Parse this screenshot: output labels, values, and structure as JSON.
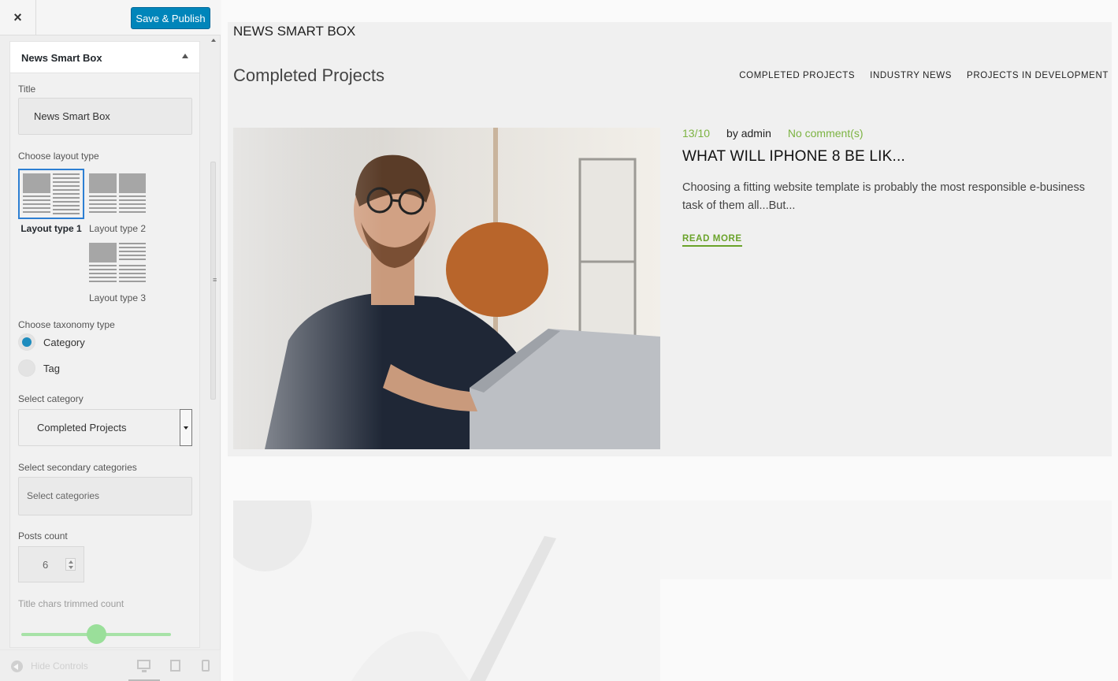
{
  "topbar": {
    "close_symbol": "×",
    "save_label": "Save & Publish"
  },
  "section": {
    "title": "News Smart Box"
  },
  "form": {
    "title_label": "Title",
    "title_value": "News Smart Box",
    "layout_label": "Choose layout type",
    "layouts": [
      {
        "label": "Layout type 1",
        "selected": true
      },
      {
        "label": "Layout type 2",
        "selected": false
      },
      {
        "label": "Layout type 3",
        "selected": false
      }
    ],
    "taxonomy_label": "Choose taxonomy type",
    "taxonomy_options": [
      {
        "label": "Category",
        "selected": true
      },
      {
        "label": "Tag",
        "selected": false
      }
    ],
    "category_label": "Select category",
    "category_value": "Completed Projects",
    "secondary_label": "Select secondary categories",
    "secondary_placeholder": "Select categories",
    "posts_count_label": "Posts count",
    "posts_count_value": "6",
    "title_chars_label": "Title chars trimmed count",
    "title_chars_level": 0.5
  },
  "footer": {
    "hide_controls_label": "Hide Controls",
    "devices": [
      "desktop-icon",
      "tablet-icon",
      "mobile-icon"
    ]
  },
  "preview": {
    "widget_title": "NEWS SMART BOX",
    "category_heading": "Completed Projects",
    "tabs": [
      "COMPLETED PROJECTS",
      "INDUSTRY NEWS",
      "PROJECTS IN DEVELOPMENT"
    ],
    "post": {
      "date": "13/10",
      "author": "by admin",
      "comments": "No comment(s)",
      "title": "WHAT WILL IPHONE 8 BE LIK...",
      "excerpt": "Choosing a fitting website template is probably the most responsible e-business task of them all...But...",
      "read_more": "READ MORE"
    }
  },
  "colors": {
    "accent_blue": "#0085ba",
    "radio_blue": "#1e8cbe",
    "green": "#7cb342",
    "slider_green": "#9adf9a"
  }
}
